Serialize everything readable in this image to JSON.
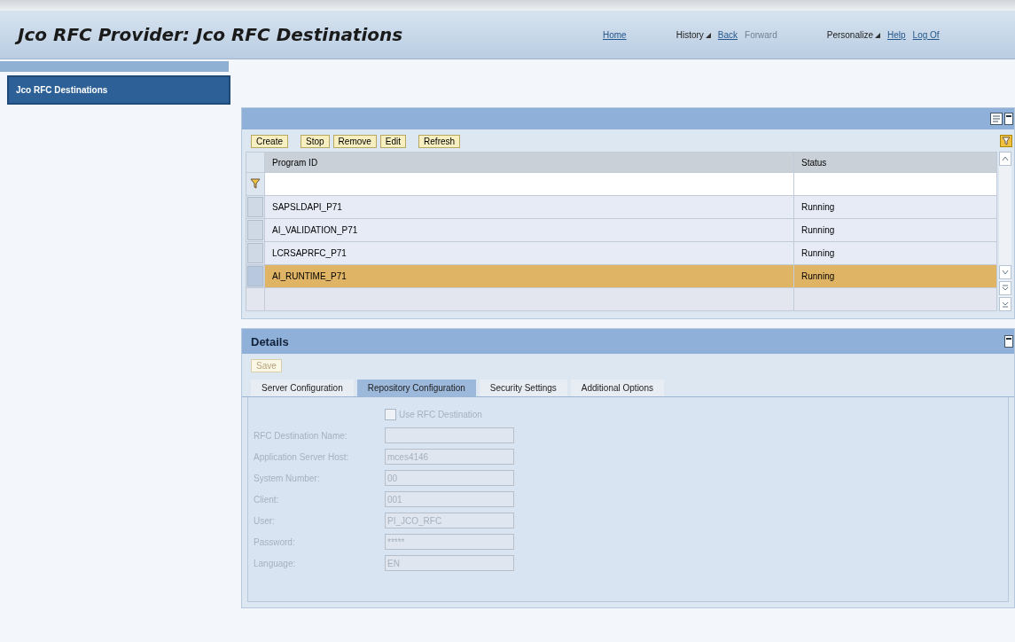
{
  "header": {
    "title": "Jco RFC Provider: Jco RFC Destinations",
    "links": [
      {
        "label": "Home",
        "kind": "link",
        "disabled": false
      },
      {
        "label": "History",
        "kind": "menu",
        "disabled": false
      },
      {
        "label": "Back",
        "kind": "link",
        "disabled": false
      },
      {
        "label": "Forward",
        "kind": "link",
        "disabled": true
      },
      {
        "label": "Personalize",
        "kind": "menu",
        "disabled": false
      },
      {
        "label": "Help",
        "kind": "link",
        "disabled": false
      },
      {
        "label": "Log Of",
        "kind": "link",
        "disabled": false
      }
    ]
  },
  "sidebar": {
    "items": [
      {
        "label": "Jco RFC Destinations",
        "selected": true
      }
    ]
  },
  "table": {
    "toolbar": [
      {
        "label": "Create"
      },
      {
        "label": "Stop"
      },
      {
        "label": "Remove"
      },
      {
        "label": "Edit"
      },
      {
        "label": "Refresh"
      }
    ],
    "columns": [
      "Program ID",
      "Status"
    ],
    "rows": [
      {
        "program_id": "SAPSLDAPI_P71",
        "status": "Running",
        "selected": false
      },
      {
        "program_id": "AI_VALIDATION_P71",
        "status": "Running",
        "selected": false
      },
      {
        "program_id": "LCRSAPRFC_P71",
        "status": "Running",
        "selected": false
      },
      {
        "program_id": "AI_RUNTIME_P71",
        "status": "Running",
        "selected": true
      }
    ]
  },
  "details": {
    "title": "Details",
    "save": {
      "label": "Save",
      "disabled": true
    },
    "tabs": [
      {
        "label": "Server Configuration",
        "selected": false
      },
      {
        "label": "Repository Configuration",
        "selected": true
      },
      {
        "label": "Security Settings",
        "selected": false
      },
      {
        "label": "Additional Options",
        "selected": false
      }
    ],
    "checkbox": {
      "label": "Use RFC Destination",
      "checked": false,
      "disabled": true
    },
    "fields": [
      {
        "label": "RFC Destination Name:",
        "disabled": true
      },
      {
        "label": "Application Server Host:",
        "value": "mces4146",
        "disabled": true
      },
      {
        "label": "System Number:",
        "value": "00",
        "disabled": true
      },
      {
        "label": "Client:",
        "value": "001",
        "disabled": true
      },
      {
        "label": "User:",
        "value": "PI_JCO_RFC",
        "disabled": true
      },
      {
        "label": "Password:",
        "value": "*****",
        "disabled": true
      },
      {
        "label": "Language:",
        "value": "EN",
        "disabled": true
      }
    ]
  }
}
